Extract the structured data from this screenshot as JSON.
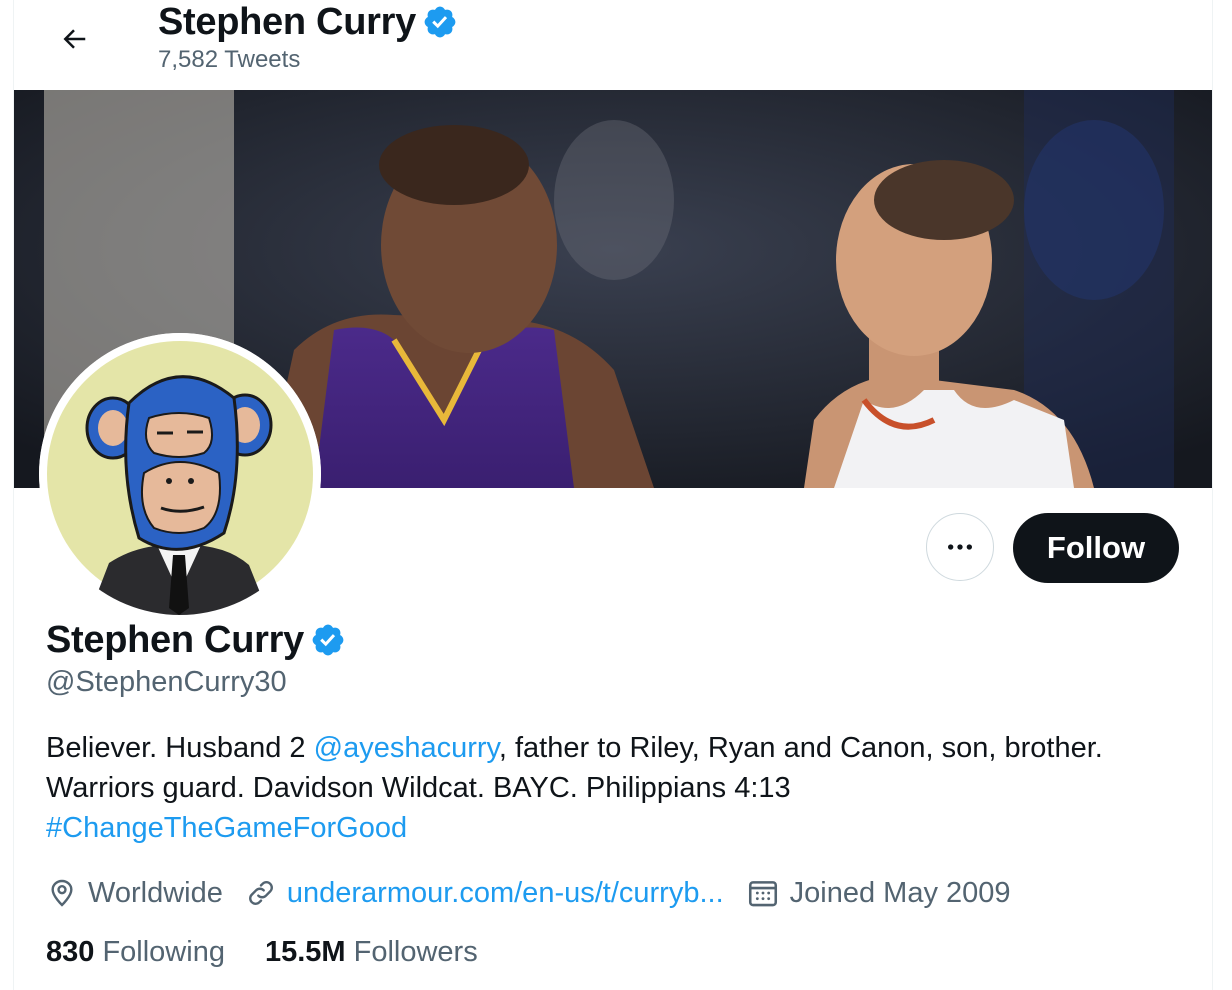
{
  "header": {
    "back_label": "Back",
    "title": "Stephen Curry",
    "tweet_count": "7,582 Tweets"
  },
  "profile": {
    "name": "Stephen Curry",
    "handle": "@StephenCurry30",
    "verified": true,
    "bio": {
      "part1": "Believer. Husband 2 ",
      "mention": "@ayeshacurry",
      "part2": ", father to Riley, Ryan and Canon, son, brother. Warriors guard. Davidson Wildcat. BAYC. Philippians 4:13",
      "hashtag": "#ChangeTheGameForGood"
    },
    "location": "Worldwide",
    "website": "underarmour.com/en-us/t/curryb...",
    "joined": "Joined May 2009",
    "following_count": "830",
    "following_label": "Following",
    "followers_count": "15.5M",
    "followers_label": "Followers"
  },
  "actions": {
    "follow_label": "Follow",
    "more_label": "More"
  },
  "icons": {
    "back": "arrow-left-icon",
    "verified": "verified-badge-icon",
    "more": "ellipsis-icon",
    "location": "location-pin-icon",
    "link": "link-icon",
    "calendar": "calendar-icon"
  },
  "colors": {
    "accent": "#1d9bf0",
    "text": "#0f1419",
    "secondary": "#536471",
    "follow_bg": "#0f1419"
  }
}
